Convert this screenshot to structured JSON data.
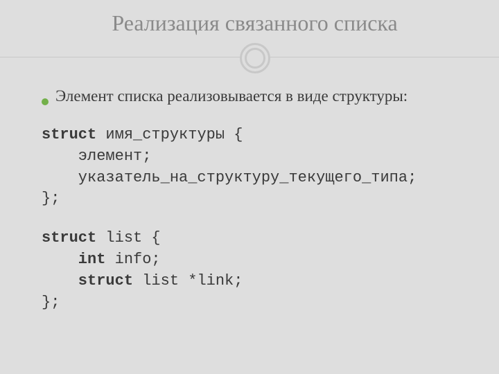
{
  "title": "Реализация связанного списка",
  "bullet": "Элемент списка реализовывается в виде структуры:",
  "code1": {
    "l1_kw": "struct",
    "l1_rest": " имя_структуры {",
    "l2": "    элемент;",
    "l3": "    указатель_на_структуру_текущего_типа;",
    "l4": "};"
  },
  "code2": {
    "l1_kw": "struct",
    "l1_rest": " list {",
    "l2_kw": "    int",
    "l2_rest": " info;",
    "l3_kw": "    struct",
    "l3_rest": " list *link;",
    "l4": "};"
  }
}
